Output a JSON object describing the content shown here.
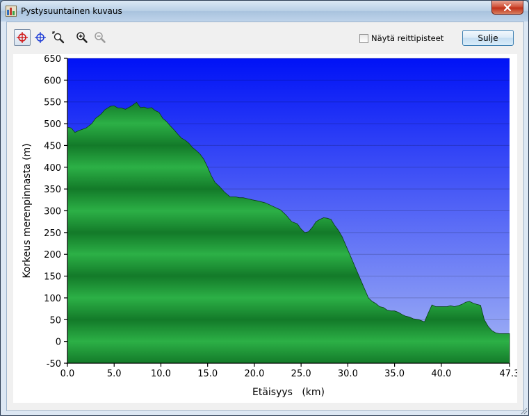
{
  "window": {
    "title": "Pystysuuntainen kuvaus",
    "icons": {
      "app": "chart-app-icon",
      "close": "close-x-icon"
    }
  },
  "toolbar": {
    "tools": [
      {
        "name": "select-crosshair-tool",
        "icon": "red-crosshair-icon",
        "active": true
      },
      {
        "name": "move-crosshair-tool",
        "icon": "blue-crosshair-icon",
        "active": false
      },
      {
        "name": "zoom-window-tool",
        "icon": "zoom-rectangle-icon",
        "active": false
      },
      {
        "name": "zoom-in-tool",
        "icon": "zoom-in-icon",
        "active": false
      },
      {
        "name": "zoom-out-tool",
        "icon": "zoom-out-icon",
        "active": false
      }
    ],
    "show_waypoints_label": "Näytä reittipisteet",
    "show_waypoints_checked": false,
    "close_label": "Sulje"
  },
  "chart_data": {
    "type": "area",
    "xlabel": "Etäisyys   (km)",
    "ylabel": "Korkeus merenpinnasta (m)",
    "xlim": [
      0,
      47.3
    ],
    "ylim": [
      -50,
      650
    ],
    "x_ticks": [
      "0.0",
      "5.0",
      "10.0",
      "15.0",
      "20.0",
      "25.0",
      "30.0",
      "35.0",
      "40.0",
      "47.3"
    ],
    "x_tick_values": [
      0,
      5,
      10,
      15,
      20,
      25,
      30,
      35,
      40,
      47.3
    ],
    "y_ticks": [
      "650",
      "600",
      "550",
      "500",
      "450",
      "400",
      "350",
      "300",
      "250",
      "200",
      "150",
      "100",
      "50",
      "0",
      "-50"
    ],
    "y_tick_values": [
      650,
      600,
      550,
      500,
      450,
      400,
      350,
      300,
      250,
      200,
      150,
      100,
      50,
      0,
      -50
    ],
    "grid": true,
    "background_colors": {
      "top": "#0012f6",
      "bottom": "#a6b7f5"
    },
    "fill_colors": {
      "light": "#2cb046",
      "dark": "#137a29"
    },
    "series": [
      {
        "x": [
          0,
          0.4,
          0.8,
          1.2,
          1.6,
          2.0,
          2.6,
          3.0,
          3.6,
          4.0,
          4.6,
          5.0,
          5.4,
          5.8,
          6.2,
          6.8,
          7.4,
          7.8,
          8.2,
          8.6,
          9.0,
          9.4,
          9.8,
          10.2,
          10.6,
          11.0,
          11.4,
          11.8,
          12.2,
          12.6,
          13.0,
          13.4,
          13.8,
          14.2,
          14.6,
          15.0,
          15.4,
          15.8,
          16.3,
          16.8,
          17.4,
          18.0,
          18.4,
          18.8,
          19.2,
          19.8,
          20.5,
          21.2,
          22.0,
          22.8,
          23.4,
          24.0,
          24.6,
          25.0,
          25.4,
          25.8,
          26.2,
          26.6,
          27.0,
          27.4,
          27.8,
          28.2,
          28.6,
          29.0,
          29.4,
          29.8,
          30.2,
          30.6,
          31.0,
          31.4,
          31.8,
          32.2,
          32.6,
          33.0,
          33.4,
          33.8,
          34.2,
          34.6,
          35.0,
          35.4,
          35.8,
          36.2,
          36.6,
          37.0,
          37.6,
          38.2,
          38.6,
          39.0,
          39.4,
          39.8,
          40.2,
          40.6,
          41.0,
          41.4,
          41.8,
          42.2,
          42.6,
          43.0,
          43.4,
          43.8,
          44.2,
          44.6,
          45.0,
          45.4,
          45.8,
          46.2,
          46.6,
          47.0,
          47.3
        ],
        "y": [
          492,
          490,
          480,
          484,
          487,
          490,
          500,
          512,
          522,
          532,
          540,
          541,
          536,
          536,
          533,
          540,
          549,
          537,
          538,
          535,
          537,
          530,
          526,
          512,
          505,
          495,
          486,
          476,
          467,
          462,
          455,
          445,
          438,
          430,
          418,
          400,
          380,
          365,
          355,
          343,
          332,
          332,
          330,
          330,
          328,
          325,
          322,
          318,
          310,
          302,
          290,
          275,
          270,
          258,
          250,
          252,
          262,
          275,
          280,
          284,
          283,
          280,
          266,
          255,
          240,
          220,
          200,
          180,
          160,
          140,
          120,
          100,
          92,
          87,
          80,
          78,
          72,
          70,
          70,
          67,
          62,
          58,
          56,
          52,
          50,
          45,
          65,
          84,
          80,
          80,
          80,
          80,
          82,
          80,
          82,
          85,
          90,
          92,
          88,
          85,
          83,
          50,
          35,
          25,
          20,
          18,
          18,
          18,
          18
        ]
      }
    ]
  }
}
